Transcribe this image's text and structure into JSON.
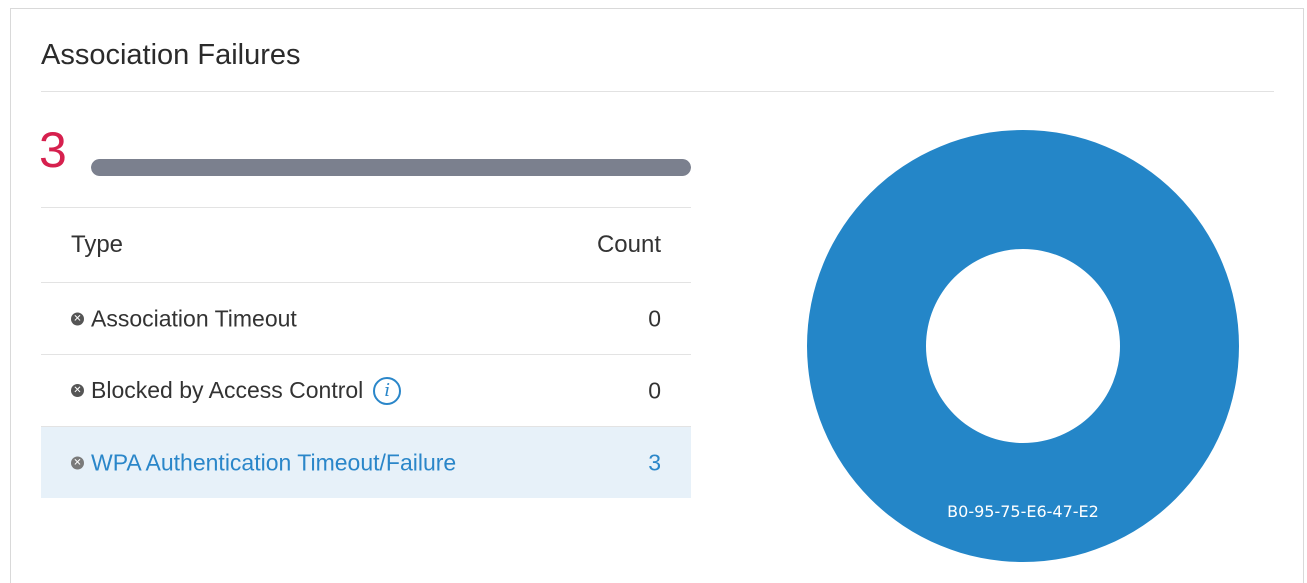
{
  "card": {
    "title": "Association Failures"
  },
  "summary": {
    "total": "3",
    "bar_fill_fraction": 1.0,
    "bar_color": "#7b808e",
    "total_color": "#d6204e"
  },
  "table": {
    "headers": {
      "type": "Type",
      "count": "Count"
    },
    "rows": [
      {
        "icon": "x-circle-icon",
        "type": "Association Timeout",
        "count": "0",
        "info": false,
        "highlighted": false
      },
      {
        "icon": "x-circle-icon",
        "type": "Blocked by Access Control",
        "count": "0",
        "info": true,
        "highlighted": false
      },
      {
        "icon": "x-circle-icon",
        "type": "WPA Authentication Timeout/Failure",
        "count": "3",
        "info": false,
        "highlighted": true
      }
    ]
  },
  "chart_data": {
    "type": "pie",
    "donut": true,
    "slices": [
      {
        "label": "B0-95-75-E6-47-E2",
        "value": 3,
        "color": "#2486c8"
      }
    ]
  },
  "colors": {
    "accent": "#2a86c9",
    "highlight_row": "#e7f1f9"
  }
}
